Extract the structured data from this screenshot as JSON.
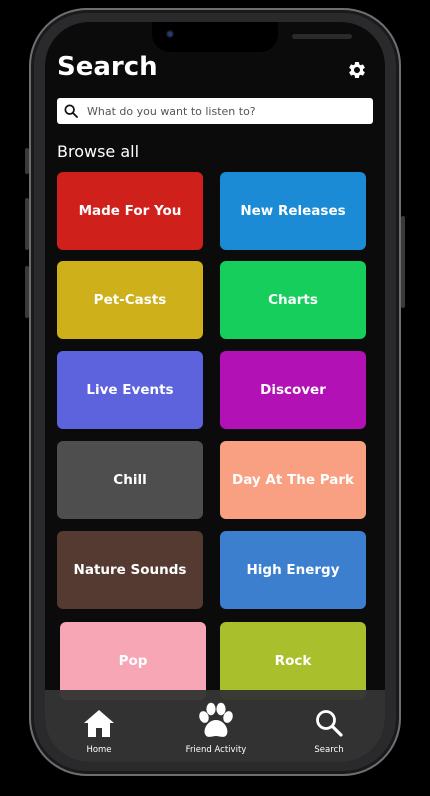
{
  "header": {
    "title": "Search",
    "settings_icon": "gear-icon"
  },
  "search": {
    "placeholder": "What do you want to listen to?",
    "value": "",
    "icon": "search-icon"
  },
  "browse": {
    "heading": "Browse all",
    "categories": [
      {
        "label": "Made For You",
        "color": "#D0201B"
      },
      {
        "label": "New Releases",
        "color": "#1A8BD4"
      },
      {
        "label": "Pet-Casts",
        "color": "#CDB01A"
      },
      {
        "label": "Charts",
        "color": "#16CE5B"
      },
      {
        "label": "Live Events",
        "color": "#5D63DC"
      },
      {
        "label": "Discover",
        "color": "#B212B5"
      },
      {
        "label": "Chill",
        "color": "#4E4E4E"
      },
      {
        "label": "Day At The Park",
        "color": "#F8A081"
      },
      {
        "label": "Nature Sounds",
        "color": "#543A31"
      },
      {
        "label": "High Energy",
        "color": "#3C7FCE"
      },
      {
        "label": "Pop",
        "color": "#F6A6B4"
      },
      {
        "label": "Rock",
        "color": "#A9C02C"
      }
    ]
  },
  "tabbar": {
    "items": [
      {
        "label": "Home",
        "icon": "home-icon"
      },
      {
        "label": "Friend Activity",
        "icon": "paw-icon"
      },
      {
        "label": "Search",
        "icon": "search-icon"
      }
    ]
  }
}
